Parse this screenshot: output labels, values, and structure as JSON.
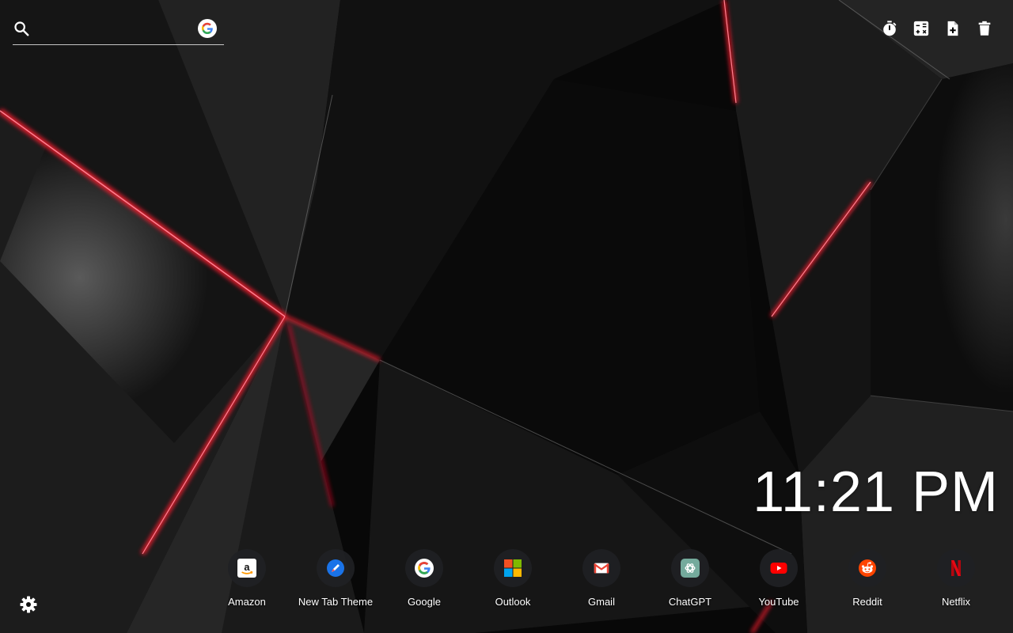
{
  "search": {
    "value": "",
    "placeholder": "",
    "icon": "search-icon",
    "engine_icon": "google-icon"
  },
  "toolbar": {
    "icons": [
      "timer-icon",
      "calculator-icon",
      "add-note-icon",
      "trash-icon"
    ]
  },
  "clock": {
    "time": "11:21 PM"
  },
  "shortcuts": [
    {
      "label": "Amazon",
      "icon": "amazon-icon"
    },
    {
      "label": "New Tab Theme",
      "icon": "new-tab-theme-icon"
    },
    {
      "label": "Google",
      "icon": "google-icon"
    },
    {
      "label": "Outlook",
      "icon": "outlook-icon"
    },
    {
      "label": "Gmail",
      "icon": "gmail-icon"
    },
    {
      "label": "ChatGPT",
      "icon": "chatgpt-icon"
    },
    {
      "label": "YouTube",
      "icon": "youtube-icon"
    },
    {
      "label": "Reddit",
      "icon": "reddit-icon"
    },
    {
      "label": "Netflix",
      "icon": "netflix-icon"
    }
  ],
  "settings": {
    "icon": "gear-icon"
  },
  "colors": {
    "background": "#070707",
    "accent_red": "#ff1a2e",
    "text": "#ffffff",
    "shortcut_circle": "#202124"
  }
}
